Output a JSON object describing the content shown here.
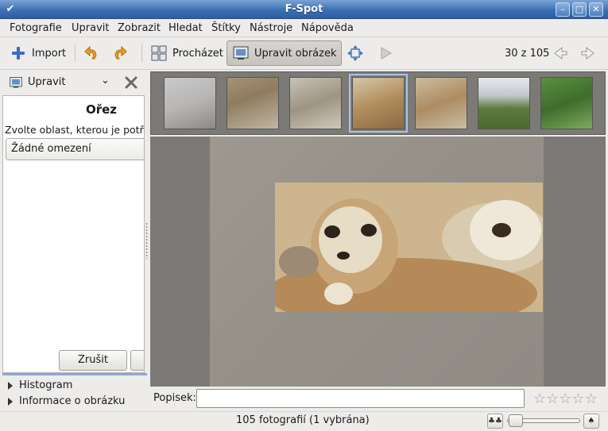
{
  "window": {
    "title": "F-Spot",
    "controls": [
      "minimize",
      "maximize",
      "close"
    ]
  },
  "menu": [
    "Fotografie",
    "Upravit",
    "Zobrazit",
    "Hledat",
    "Štítky",
    "Nástroje",
    "Nápověda"
  ],
  "toolbar": {
    "import_label": "Import",
    "browse_label": "Procházet",
    "edit_label": "Upravit obrázek",
    "position_text": "30 z 105"
  },
  "left_panel": {
    "mode_label": "Upravit",
    "heading": "Ořez",
    "hint": "Zvolte oblast, kterou je potřeba oříznout.",
    "constraint_value": "Žádné omezení",
    "cancel_label": "Zrušit",
    "histogram_label": "Histogram",
    "image_info_label": "Informace o obrázku"
  },
  "filmstrip": {
    "thumbnails": [
      "giraffe-1",
      "giraffe-2",
      "giraffe-3",
      "meerkats-1",
      "meerkats-2",
      "landscape",
      "garden"
    ],
    "selected_index": 3
  },
  "caption": {
    "label": "Popisek:",
    "value": ""
  },
  "rating": {
    "stars": 5,
    "filled": 0
  },
  "status": {
    "text": "105 fotografií (1 vybrána)"
  },
  "zoom": {
    "level": 0.05
  },
  "colors": {
    "titlebar": "#3d70b3",
    "selection": "#a9c4e8",
    "accent": "#88a9d6"
  }
}
